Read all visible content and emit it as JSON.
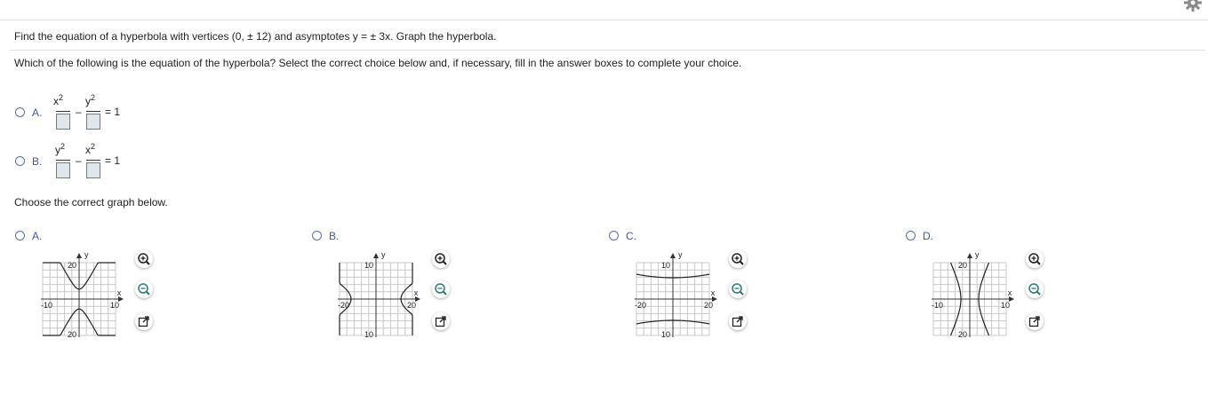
{
  "question": "Find the equation of a hyperbola with vertices (0, ± 12) and asymptotes y = ± 3x. Graph the hyperbola.",
  "prompt": "Which of the following is the equation of the hyperbola? Select the correct choice below and, if necessary, fill in the answer boxes to complete your choice.",
  "equation_choices": [
    {
      "letter": "A.",
      "first_var": "x",
      "second_var": "y",
      "power": "2",
      "minus": "–",
      "rhs": "= 1"
    },
    {
      "letter": "B.",
      "first_var": "y",
      "second_var": "x",
      "power": "2",
      "minus": "–",
      "rhs": "= 1"
    }
  ],
  "graph_prompt": "Choose the correct graph below.",
  "graph_choices": [
    {
      "letter": "A.",
      "orientation": "vertical-opening",
      "top_label": "20",
      "bottom_label": "20",
      "left_label": "-10",
      "right_label": "10",
      "x_axis": "x",
      "y_axis": "y"
    },
    {
      "letter": "B.",
      "orientation": "horizontal-opening",
      "top_label": "10",
      "bottom_label": "10",
      "left_label": "-20",
      "right_label": "20",
      "x_axis": "x",
      "y_axis": "y"
    },
    {
      "letter": "C.",
      "orientation": "vertical-opening",
      "top_label": "10",
      "bottom_label": "10",
      "left_label": "-20",
      "right_label": "20",
      "x_axis": "x",
      "y_axis": "y"
    },
    {
      "letter": "D.",
      "orientation": "horizontal-opening",
      "top_label": "20",
      "bottom_label": "20",
      "left_label": "-10",
      "right_label": "10",
      "x_axis": "x",
      "y_axis": "y"
    }
  ],
  "graph_tools": [
    "zoom-in-icon",
    "zoom-out-icon",
    "expand-icon"
  ],
  "colors": {
    "radio_border": "#5a6fa8",
    "answer_box": "#dfe6ee",
    "choice_letter": "#3c5aa8"
  }
}
